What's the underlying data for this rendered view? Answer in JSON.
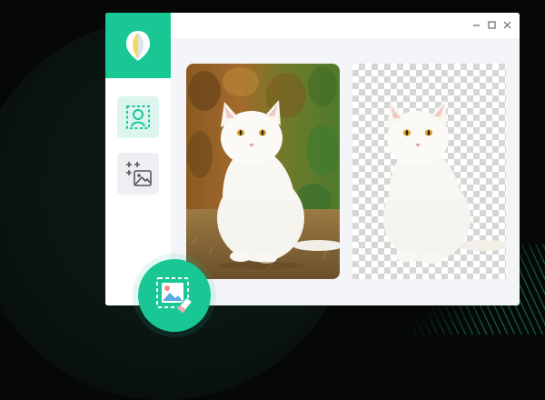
{
  "app": {
    "accent_color": "#19c795",
    "logo_icon": "leaf-logo-icon"
  },
  "sidebar": {
    "tools": [
      {
        "icon": "person-select-icon",
        "state": "active"
      },
      {
        "icon": "add-image-icon",
        "state": "inactive"
      }
    ]
  },
  "window_controls": [
    "minimize-icon",
    "maximize-icon",
    "close-icon"
  ],
  "canvas": {
    "original": {
      "subject": "white-cat-photo",
      "background": "nature"
    },
    "result": {
      "subject": "white-cat-cutout",
      "background": "transparent-checkerboard"
    }
  },
  "badge": {
    "icon": "image-eraser-icon"
  }
}
